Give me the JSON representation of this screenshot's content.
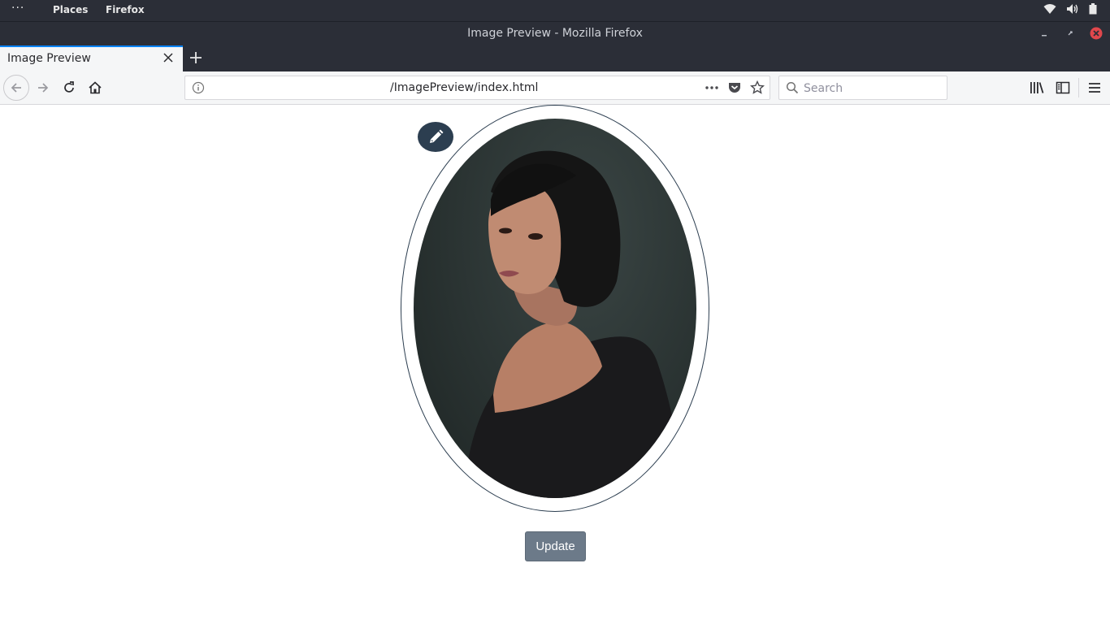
{
  "system_bar": {
    "activities": "···",
    "places": "Places",
    "app": "Firefox"
  },
  "window": {
    "title": "Image Preview - Mozilla Firefox"
  },
  "tabs": [
    {
      "label": "Image Preview",
      "active": true
    }
  ],
  "navbar": {
    "url": "/ImagePreview/index.html",
    "search_placeholder": "Search"
  },
  "page": {
    "update_label": "Update"
  },
  "colors": {
    "accent": "#0a84ff",
    "frame": "#2c3e50",
    "update_button": "#6c7a89",
    "close_red": "#e0474c"
  }
}
